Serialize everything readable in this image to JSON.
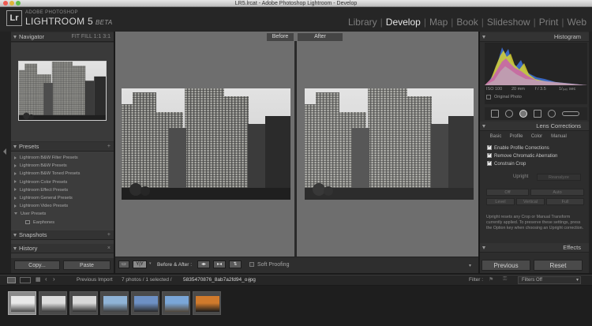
{
  "window": {
    "title": "LR5.lrcat - Adobe Photoshop Lightroom - Develop"
  },
  "identity": {
    "small": "ADOBE PHOTOSHOP",
    "name": "LIGHTROOM 5",
    "beta": "BETA"
  },
  "modules": [
    {
      "label": "Library",
      "active": false
    },
    {
      "label": "Develop",
      "active": true
    },
    {
      "label": "Map",
      "active": false
    },
    {
      "label": "Book",
      "active": false
    },
    {
      "label": "Slideshow",
      "active": false
    },
    {
      "label": "Print",
      "active": false
    },
    {
      "label": "Web",
      "active": false
    }
  ],
  "navigator": {
    "title": "Navigator",
    "zoom_options": [
      "FIT",
      "FILL",
      "1:1",
      "3:1"
    ]
  },
  "presets": {
    "title": "Presets",
    "add": "+",
    "items": [
      {
        "label": "Lightroom B&W Filter Presets"
      },
      {
        "label": "Lightroom B&W Presets"
      },
      {
        "label": "Lightroom B&W Toned Presets"
      },
      {
        "label": "Lightroom Color Presets"
      },
      {
        "label": "Lightroom Effect Presets"
      },
      {
        "label": "Lightroom General Presets"
      },
      {
        "label": "Lightroom Video Presets"
      },
      {
        "label": "User Presets"
      },
      {
        "label": "Earphones"
      }
    ]
  },
  "snapshots": {
    "title": "Snapshots",
    "add": "+"
  },
  "history": {
    "title": "History",
    "clear": "×"
  },
  "left_buttons": {
    "copy": "Copy...",
    "paste": "Paste"
  },
  "view": {
    "before": "Before",
    "after": "After"
  },
  "toolbar": {
    "yy": "Y|Y",
    "before_after_label": "Before & After :",
    "soft_proofing": "Soft Proofing"
  },
  "histogram": {
    "title": "Histogram",
    "iso": "ISO 100",
    "focal": "20 mm",
    "aperture": "f / 3.5",
    "shutter": "1/₆₄₀ sec",
    "original_photo": "Original Photo"
  },
  "lens_corrections": {
    "title": "Lens Corrections",
    "tabs": [
      {
        "label": "Basic",
        "active": true
      },
      {
        "label": "Profile",
        "active": false
      },
      {
        "label": "Color",
        "active": false
      },
      {
        "label": "Manual",
        "active": false
      }
    ],
    "checks": [
      "Enable Profile Corrections",
      "Remove Chromatic Aberration",
      "Constrain Crop"
    ],
    "upright_label": "Upright",
    "reanalyze": "Reanalyze",
    "upright_buttons": [
      "Off",
      "Auto",
      "Level",
      "Vertical",
      "Full"
    ],
    "note": "Upright resets any Crop or Manual Transform currently applied. To preserve these settings, press the Option key when choosing an Upright correction."
  },
  "effects": {
    "title": "Effects"
  },
  "right_buttons": {
    "previous": "Previous",
    "reset": "Reset"
  },
  "filmstrip_bar": {
    "source": "Previous Import",
    "count": "7 photos / 1 selected /",
    "filename": "5835470876_8ab7a2fd94_o.jpg",
    "filter_label": "Filter :",
    "filter_value": "Filters Off"
  },
  "filmstrip": {
    "thumbs": [
      {
        "selected": true,
        "sky": "#e9e9e9",
        "ground": "#4a4a4a"
      },
      {
        "selected": false,
        "sky": "#dcdcdc",
        "ground": "#3a3a3a"
      },
      {
        "selected": false,
        "sky": "#d8d8d8",
        "ground": "#2f2f2f"
      },
      {
        "selected": false,
        "sky": "#8fb3d6",
        "ground": "#3d3d3d"
      },
      {
        "selected": false,
        "sky": "#6d90c4",
        "ground": "#2a2a2a"
      },
      {
        "selected": false,
        "sky": "#7aa6d8",
        "ground": "#51473a"
      },
      {
        "selected": false,
        "sky": "#d07a2c",
        "ground": "#1b1b1b"
      }
    ]
  },
  "colors": {
    "accent": "#e6e6e6",
    "panel": "#2d2d2d",
    "canvas": "#6e6e6e"
  }
}
